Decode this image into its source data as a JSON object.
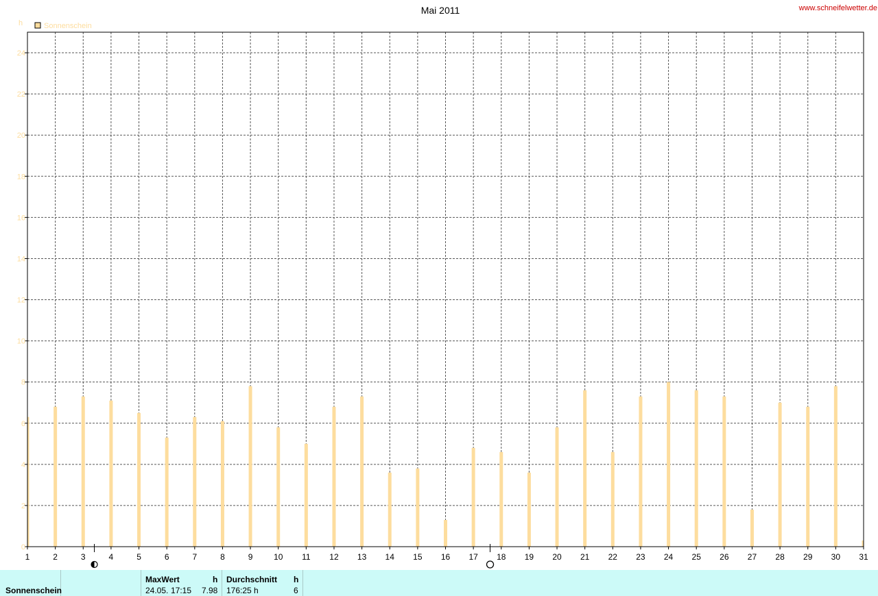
{
  "site_url": "www.schneifelwetter.de",
  "colors": {
    "bar": "#fddd9e",
    "axis": "#000000",
    "tick_label": "#fddd9e",
    "grid": "#555555",
    "url": "#cc0000",
    "footer_bg": "#ccfaf8"
  },
  "chart_data": {
    "type": "bar",
    "title": "Mai 2011",
    "ylabel": "h",
    "xlabel": "",
    "ylim": [
      0,
      25
    ],
    "yticks": [
      0,
      2,
      4,
      6,
      8,
      10,
      12,
      14,
      16,
      18,
      20,
      22,
      24
    ],
    "xlim": [
      1,
      31
    ],
    "grid": true,
    "legend_position": "top-left",
    "categories": [
      1,
      2,
      3,
      4,
      5,
      6,
      7,
      8,
      9,
      10,
      11,
      12,
      13,
      14,
      15,
      16,
      17,
      18,
      19,
      20,
      21,
      22,
      23,
      24,
      25,
      26,
      27,
      28,
      29,
      30,
      31
    ],
    "series": [
      {
        "name": "Sonnenschein",
        "values": [
          6.3,
          6.8,
          7.3,
          7.1,
          6.5,
          5.3,
          6.3,
          6.1,
          7.8,
          5.8,
          5.0,
          6.8,
          7.3,
          3.6,
          3.8,
          1.3,
          4.8,
          4.6,
          3.6,
          5.8,
          7.6,
          4.6,
          7.3,
          8.0,
          7.6,
          7.3,
          1.8,
          7.0,
          6.8,
          7.8,
          0.3
        ]
      }
    ],
    "moon_phases": [
      {
        "day": 3.4,
        "phase": "last-quarter"
      },
      {
        "day": 17.6,
        "phase": "full-moon"
      }
    ]
  },
  "footer": {
    "row_label": "Sonnenschein",
    "max": {
      "header": "MaxWert",
      "unit": "h",
      "date": "24.05.",
      "time": "17:15",
      "value": "7.98"
    },
    "avg": {
      "header": "Durchschnitt",
      "unit": "h",
      "total": "176:25 h",
      "value": "6"
    }
  }
}
